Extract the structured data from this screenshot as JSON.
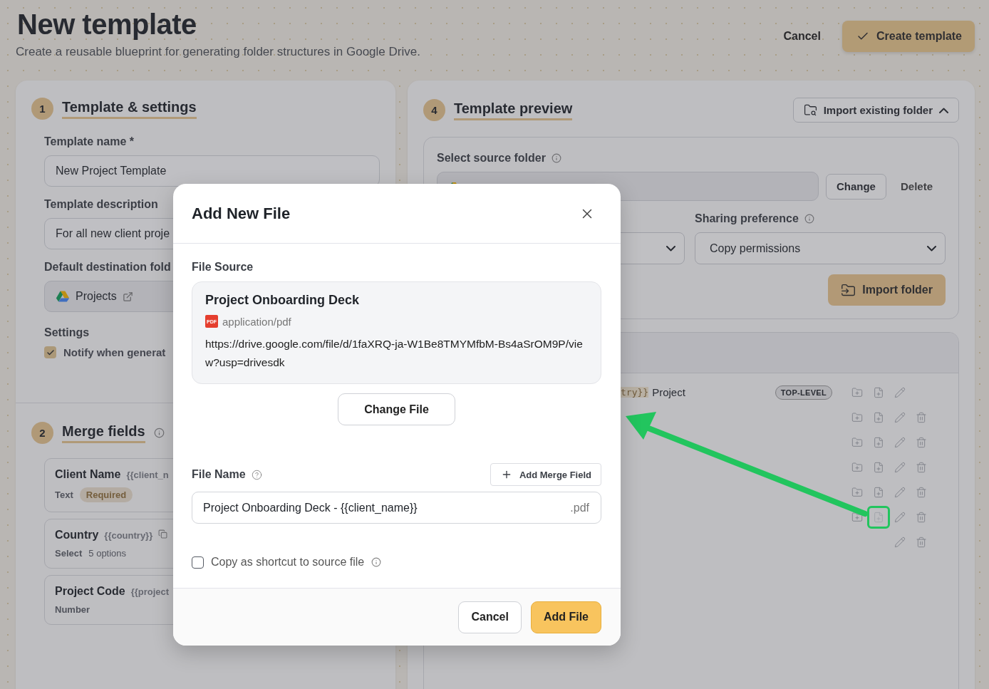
{
  "header": {
    "title": "New template",
    "subtitle": "Create a reusable blueprint for generating folder structures in Google Drive.",
    "actions": [
      {
        "label": "Cancel",
        "kind": "text"
      },
      {
        "label": "Create template",
        "kind": "primary"
      }
    ]
  },
  "settings": {
    "step": "1",
    "title": "Template & settings",
    "name_label": "Template name",
    "required_mark": "*",
    "name_value": "New Project Template",
    "description_label": "Template description",
    "description_value": "For all new client proje",
    "destination_label": "Default destination fold",
    "destination_value": "Projects",
    "settings_label": "Settings",
    "notify": {
      "label": "Notify when generat",
      "checked": true
    }
  },
  "merge_fields": {
    "step": "2",
    "title": "Merge fields",
    "items": [
      {
        "name": "Client Name",
        "token": "{{client_n",
        "type": "Text",
        "badge": "Required"
      },
      {
        "name": "Country",
        "token": "{{country}}",
        "type": "Select",
        "detail": "5 options",
        "copyable": true
      },
      {
        "name": "Project Code",
        "token": "{{project",
        "type": "Number"
      }
    ]
  },
  "preview": {
    "step": "4",
    "title": "Template preview",
    "import_button": {
      "label": "Import existing folder",
      "expanded": true
    },
    "source_label": "Select source folder",
    "change": "Change",
    "delete": "Delete",
    "sharing_label": "Sharing preference",
    "sharing_value": "Copy permissions",
    "import_folder": "Import folder",
    "tree": {
      "rows": [
        {
          "token": "try}}",
          "label": "Project",
          "badge": "TOP-LEVEL",
          "actions": [
            {
              "kind": "add-folder",
              "highlighted": false
            },
            {
              "kind": "add-file",
              "highlighted": false
            },
            {
              "kind": "edit",
              "highlighted": false
            }
          ]
        },
        {
          "actions": [
            {
              "kind": "add-folder",
              "highlighted": false
            },
            {
              "kind": "add-file",
              "highlighted": false
            },
            {
              "kind": "edit",
              "highlighted": false
            },
            {
              "kind": "delete",
              "highlighted": false
            }
          ]
        },
        {
          "actions": [
            {
              "kind": "add-folder",
              "highlighted": false
            },
            {
              "kind": "add-file",
              "highlighted": false
            },
            {
              "kind": "edit",
              "highlighted": false
            },
            {
              "kind": "delete",
              "highlighted": false
            }
          ]
        },
        {
          "actions": [
            {
              "kind": "add-folder",
              "highlighted": false
            },
            {
              "kind": "add-file",
              "highlighted": false
            },
            {
              "kind": "edit",
              "highlighted": false
            },
            {
              "kind": "delete",
              "highlighted": false
            }
          ]
        },
        {
          "actions": [
            {
              "kind": "add-folder",
              "highlighted": false
            },
            {
              "kind": "add-file",
              "highlighted": false
            },
            {
              "kind": "edit",
              "highlighted": false
            },
            {
              "kind": "delete",
              "highlighted": false
            }
          ]
        },
        {
          "actions": [
            {
              "kind": "add-folder",
              "highlighted": false
            },
            {
              "kind": "add-file",
              "highlighted": true
            },
            {
              "kind": "edit",
              "highlighted": false
            },
            {
              "kind": "delete",
              "highlighted": false
            }
          ]
        },
        {
          "actions": [
            {
              "kind": "edit",
              "highlighted": false
            },
            {
              "kind": "delete",
              "highlighted": false
            }
          ]
        }
      ]
    }
  },
  "modal": {
    "title": "Add New File",
    "source_label": "File Source",
    "file": {
      "name": "Project Onboarding Deck",
      "icon_label": "PDF",
      "mime": "application/pdf",
      "url": "https://drive.google.com/file/d/1faXRQ-ja-W1Be8TMYMfbM-Bs4aSrOM9P/view?usp=drivesdk"
    },
    "change_file": "Change File",
    "file_name_label": "File Name",
    "add_merge_field": "Add Merge Field",
    "file_name_value": "Project Onboarding Deck - {{client_name}}",
    "extension": ".pdf",
    "shortcut": {
      "label": "Copy as shortcut to source file",
      "checked": false
    },
    "buttons": [
      {
        "label": "Cancel",
        "kind": "secondary"
      },
      {
        "label": "Add File",
        "kind": "primary"
      }
    ]
  }
}
